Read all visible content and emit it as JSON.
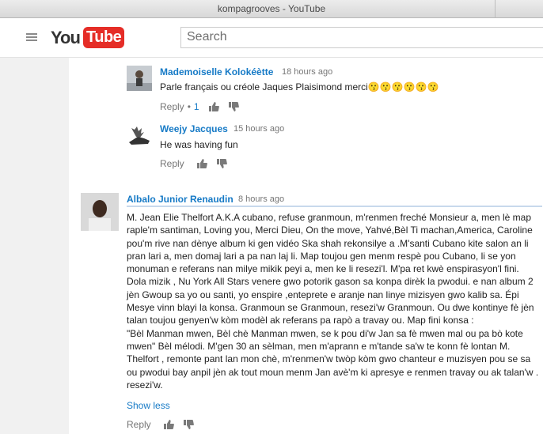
{
  "window": {
    "title": "kompagrooves - YouTube"
  },
  "header": {
    "logo_you": "You",
    "logo_tube": "Tube",
    "search_placeholder": "Search"
  },
  "comments": [
    {
      "author": "Mademoiselle Kolokéètte",
      "time": "18 hours ago",
      "text": "Parle français ou créole Jaques Plaisimond merci😗😗😗😗😗😗",
      "reply_label": "Reply",
      "dot": "•",
      "likes": "1"
    },
    {
      "author": "Weejy Jacques",
      "time": "15 hours ago",
      "text": "He was having fun",
      "reply_label": "Reply"
    },
    {
      "author": "Albalo Junior Renaudin",
      "time": "8 hours ago",
      "text": "M. Jean Elie Thelfort A.K.A cubano, refuse granmoun, m'renmen freché Monsieur a, men lè map raple'm santiman, Loving you, Merci Dieu, On the move, Yahvé,Bèl Ti machan,America, Caroline pou'm rive nan dènye album ki gen vidéo Ska shah rekonsilye a .M'santi Cubano kite salon an li pran lari a, men domaj lari a pa nan laj li. Map toujou gen menm respè pou Cubano, li se yon monuman e referans nan milye mikik peyi a, men ke li resezi'l. M'pa ret kwè enspirasyon'l fini. Dola mizik , Nu York All Stars venere gwo potorik gason sa konpa dirèk la pwodui. e nan album 2 jèn Gwoup sa yo ou santi, yo enspire ,enteprete e aranje nan linye mizisyen gwo kalib sa. Épi Mesye vinn blayi la konsa. Granmoun se Granmoun, resezi'w Granmoun. Ou dwe kontinye fè jèn talan toujou genyen'w kòm modèl ak referans pa rapò a travay ou. Map fini konsa :\n\"Bèl Manman mwen, Bèl chè Manman mwen, se k pou di'w Jan sa fè mwen mal ou pa bò kote mwen\" Bèl mélodi. M'gen 30 an sèlman, men m'aprann e m'tande sa'w te konn fè lontan M. Thelfort , remonte pant lan mon chè, m'renmen'w twòp kòm gwo chanteur e muzisyen pou se sa ou pwodui bay anpil jèn ak tout moun menm Jan avè'm ki apresye e renmen travay ou ak talan'w . resezi'w.",
      "show_less": "Show less",
      "reply_label": "Reply"
    }
  ],
  "colors": {
    "link": "#167ac6",
    "logo_red": "#e52d27",
    "background": "#f1f1f1"
  }
}
